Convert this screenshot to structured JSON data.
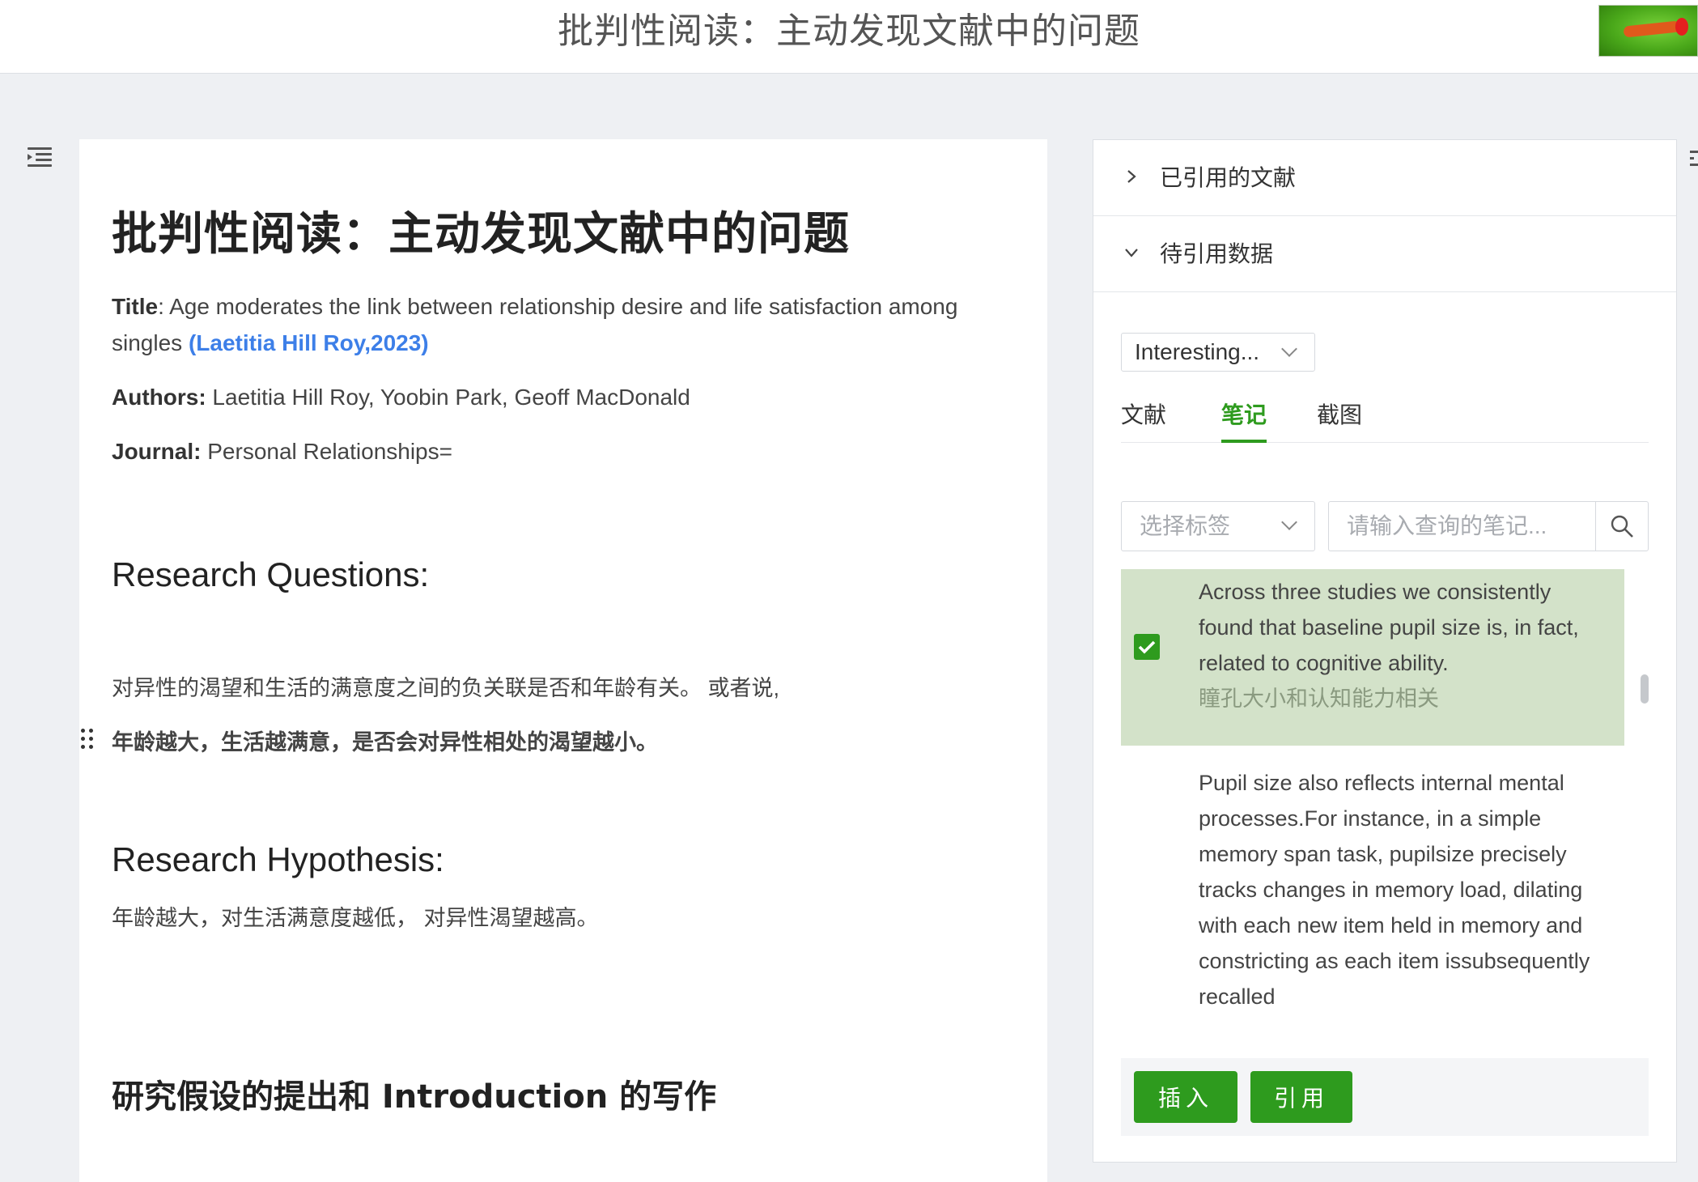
{
  "header": {
    "title": "批判性阅读：主动发现文献中的问题"
  },
  "document": {
    "heading": "批判性阅读：主动发现文献中的问题",
    "title_label": "Title",
    "title_value": ": Age moderates the link between relationship desire and life satisfaction among singles ",
    "title_citation": "(Laetitia Hill Roy,2023)",
    "authors_label": "Authors:",
    "authors_value": " Laetitia Hill Roy, Yoobin Park, Geoff MacDonald",
    "journal_label": "Journal:",
    "journal_value": " Personal Relationships=",
    "section_rq": "Research Questions:",
    "rq_line1": "对异性的渴望和生活的满意度之间的负关联是否和年龄有关。 或者说,",
    "rq_line2": "年龄越大，生活越满意，是否会对异性相处的渴望越小。",
    "section_rh": "Research Hypothesis:",
    "rh_line1": "年龄越大，对生活满意度越低， 对异性渴望越高。",
    "section_intro": "研究假设的提出和 Introduction 的写作"
  },
  "panel": {
    "cited_refs": "已引用的文献",
    "pending_data": "待引用数据",
    "collection_select": "Interesting...",
    "tabs": [
      "文献",
      "笔记",
      "截图"
    ],
    "active_tab": "笔记",
    "tag_select_placeholder": "选择标签",
    "search_placeholder": "请输入查询的笔记...",
    "notes": [
      {
        "text": "Across three studies we consistently found that baseline pupil size is, in fact, related to cognitive ability.",
        "annotation": "瞳孔大小和认知能力相关",
        "checked": true
      },
      {
        "text": "Pupil size also reflects internal mental processes.For instance, in a simple memory span task, pupilsize precisely tracks changes in memory load, dilating with each new item held in memory and constricting as each item issubsequently recalled",
        "annotation": "",
        "checked": false
      }
    ],
    "insert_button": "插入",
    "cite_button": "引用"
  },
  "colors": {
    "accent_green": "#2e9b1e",
    "citation_blue": "#3d7fe8",
    "selected_note_bg": "#d3e2c9"
  }
}
